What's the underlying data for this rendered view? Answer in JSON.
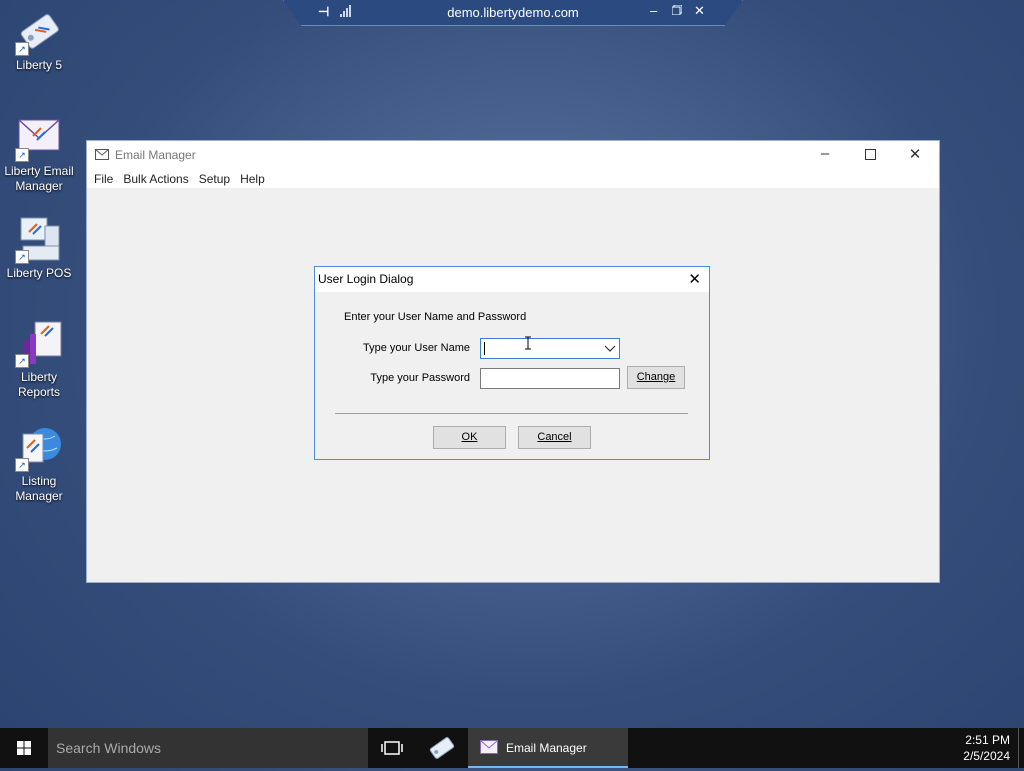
{
  "remote_bar": {
    "title": "demo.libertydemo.com"
  },
  "desktop": {
    "icons": [
      {
        "label": "Liberty 5"
      },
      {
        "label": "Liberty Email Manager"
      },
      {
        "label": "Liberty POS"
      },
      {
        "label": "Liberty Reports"
      },
      {
        "label": "Listing Manager"
      }
    ]
  },
  "window": {
    "title": "Email Manager",
    "menu": [
      "File",
      "Bulk Actions",
      "Setup",
      "Help"
    ]
  },
  "dialog": {
    "title": "User Login Dialog",
    "prompt": "Enter your User Name and Password",
    "username_label": "Type your User Name",
    "username_value": "",
    "password_label": "Type your Password",
    "password_value": "",
    "change_button": "Change",
    "ok_button": "OK",
    "cancel_button": "Cancel"
  },
  "taskbar": {
    "search_placeholder": "Search Windows",
    "active_app": "Email Manager",
    "time": "2:51 PM",
    "date": "2/5/2024"
  },
  "colors": {
    "desktop_bg": "#344d7a",
    "dialog_border": "#4a90d9",
    "taskbar_bg": "#111111",
    "active_app_underline": "#76b9ed"
  }
}
